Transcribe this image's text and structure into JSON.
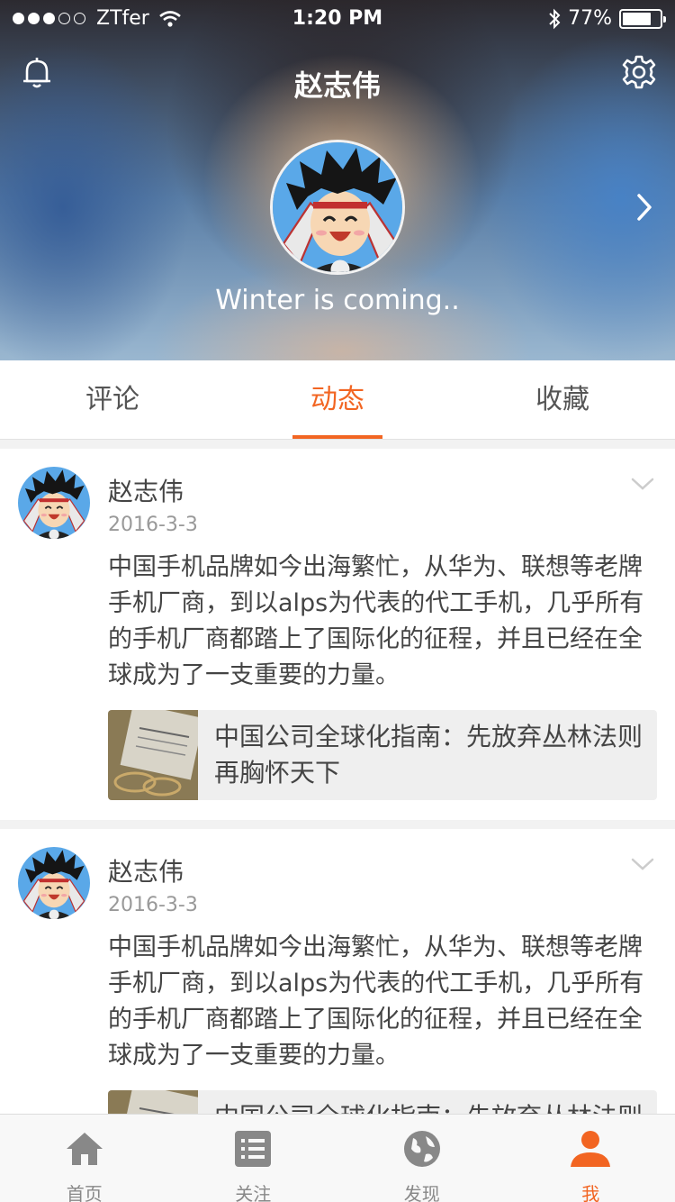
{
  "status_bar": {
    "carrier": "ZTfer",
    "time": "1:20 PM",
    "battery_percent": "77%",
    "battery_level": 0.77
  },
  "header": {
    "title": "赵志伟",
    "motto": "Winter is coming..",
    "icons": [
      "bell-icon",
      "gear-icon",
      "chevron-right-icon"
    ]
  },
  "tabs": [
    {
      "label": "评论",
      "active": false
    },
    {
      "label": "动态",
      "active": true
    },
    {
      "label": "收藏",
      "active": false
    }
  ],
  "feed": [
    {
      "name": "赵志伟",
      "date": "2016-3-3",
      "text": "中国手机品牌如今出海繁忙，从华为、联想等老牌手机厂商，到以alps为代表的代工手机，几乎所有的手机厂商都踏上了国际化的征程，并且已经在全球成为了一支重要的力量。",
      "link_title": "中国公司全球化指南：先放弃丛林法则 再胸怀天下"
    },
    {
      "name": "赵志伟",
      "date": "2016-3-3",
      "text": "中国手机品牌如今出海繁忙，从华为、联想等老牌手机厂商，到以alps为代表的代工手机，几乎所有的手机厂商都踏上了国际化的征程，并且已经在全球成为了一支重要的力量。",
      "link_title": "中国公司全球化指南：先放弃丛林法则 再胸怀天下"
    }
  ],
  "tabbar": [
    {
      "label": "首页",
      "icon": "home-icon",
      "active": false
    },
    {
      "label": "关注",
      "icon": "list-icon",
      "active": false
    },
    {
      "label": "发现",
      "icon": "globe-icon",
      "active": false
    },
    {
      "label": "我",
      "icon": "person-icon",
      "active": true
    }
  ],
  "colors": {
    "accent": "#f26522",
    "text": "#444444",
    "muted": "#999999"
  }
}
